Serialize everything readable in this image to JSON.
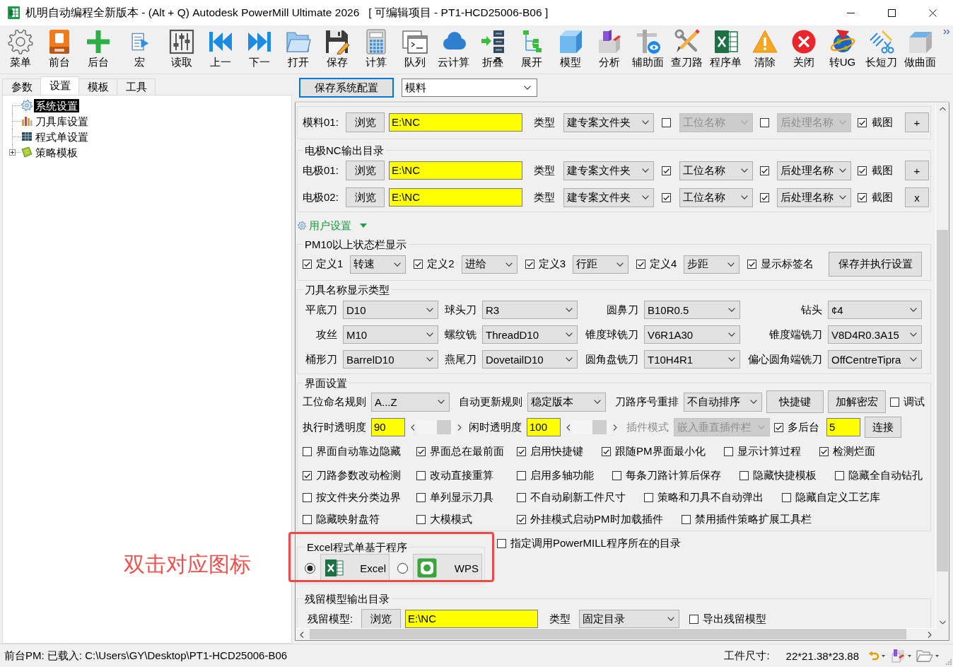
{
  "window": {
    "title": "机明自动编程全新版本 - (Alt + Q) Autodesk PowerMill Ultimate 2026   [ 可编辑项目 - PT1-HCD25006-B06 ]"
  },
  "toolbar": {
    "groups": [
      {
        "items": [
          {
            "label": "菜单"
          },
          {
            "label": "前台"
          },
          {
            "label": "后台"
          }
        ]
      },
      {
        "items": [
          {
            "label": "宏"
          }
        ]
      },
      {
        "items": [
          {
            "label": "读取"
          },
          {
            "label": "上一"
          },
          {
            "label": "下一"
          },
          {
            "label": "打开"
          },
          {
            "label": "保存"
          },
          {
            "label": "计算"
          },
          {
            "label": "队列"
          },
          {
            "label": "云计算"
          },
          {
            "label": "折叠"
          },
          {
            "label": "展开"
          },
          {
            "label": "模型"
          },
          {
            "label": "分析"
          },
          {
            "label": "辅助面"
          },
          {
            "label": "查刀路"
          },
          {
            "label": "程序单"
          },
          {
            "label": "清除"
          },
          {
            "label": "关闭"
          },
          {
            "label": "转UG"
          },
          {
            "label": "长短刀"
          },
          {
            "label": "做曲面"
          }
        ]
      }
    ]
  },
  "left_panel": {
    "tabs": [
      {
        "label": "参数",
        "selected": false
      },
      {
        "label": "设置",
        "selected": true
      },
      {
        "label": "模板",
        "selected": false
      },
      {
        "label": "工具",
        "selected": false
      }
    ],
    "tree": [
      {
        "label": "系统设置",
        "selected": true
      },
      {
        "label": "刀具库设置",
        "selected": false
      },
      {
        "label": "程式单设置",
        "selected": false
      },
      {
        "label": "策略模板",
        "selected": false,
        "expanded": false
      }
    ]
  },
  "annotation": {
    "text": "双击对应图标"
  },
  "right_panel": {
    "save_button": "保存系统配置",
    "profile": {
      "value": "模料"
    },
    "mold_output": {
      "rows": [
        {
          "label": "模料01:",
          "browse": "浏览",
          "path": "E:\\NC",
          "type_label": "类型",
          "type": "建专案文件夹",
          "station": {
            "checked": false,
            "value": "工位名称",
            "disabled": true
          },
          "post": {
            "checked": false,
            "value": "后处理名称",
            "disabled": true
          },
          "snapshot": {
            "checked": true,
            "label": "截图"
          },
          "action": "+"
        }
      ]
    },
    "electrode_output": {
      "title": "电极NC输出目录",
      "rows": [
        {
          "label": "电极01:",
          "browse": "浏览",
          "path": "E:\\NC",
          "type_label": "类型",
          "type": "建专案文件夹",
          "station": {
            "checked": true,
            "value": "工位名称",
            "disabled": false
          },
          "post": {
            "checked": true,
            "value": "后处理名称",
            "disabled": false
          },
          "snapshot": {
            "checked": true,
            "label": "截图"
          },
          "action": "+"
        },
        {
          "label": "电极02:",
          "browse": "浏览",
          "path": "E:\\NC",
          "type_label": "类型",
          "type": "建专案文件夹",
          "station": {
            "checked": true,
            "value": "工位名称",
            "disabled": false
          },
          "post": {
            "checked": true,
            "value": "后处理名称",
            "disabled": false
          },
          "snapshot": {
            "checked": true,
            "label": "截图"
          },
          "action": "x"
        }
      ]
    },
    "user_settings": {
      "label": "用户设置",
      "expanded": true
    },
    "status_display": {
      "title": "PM10以上状态栏显示",
      "fields": [
        {
          "label": "定义1",
          "checked": true,
          "value": "转速"
        },
        {
          "label": "定义2",
          "checked": true,
          "value": "进给"
        },
        {
          "label": "定义3",
          "checked": true,
          "value": "行距"
        },
        {
          "label": "定义4",
          "checked": true,
          "value": "步距"
        }
      ],
      "show_tags": {
        "label": "显示标签名",
        "checked": true
      },
      "apply_button": "保存并执行设置"
    },
    "tool_names": {
      "title": "刀具名称显示类型",
      "fields": [
        {
          "label": "平底刀",
          "value": "D10"
        },
        {
          "label": "球头刀",
          "value": "R3"
        },
        {
          "label": "圆鼻刀",
          "value": "B10R0.5"
        },
        {
          "label": "钻头",
          "value": "¢4"
        },
        {
          "label": "攻丝",
          "value": "M10"
        },
        {
          "label": "螺纹铣",
          "value": "ThreadD10"
        },
        {
          "label": "锥度球铣刀",
          "value": "V6R1A30"
        },
        {
          "label": "锥度端铣刀",
          "value": "V8D4R0.3A15"
        },
        {
          "label": "桶形刀",
          "value": "BarrelD10"
        },
        {
          "label": "燕尾刀",
          "value": "DovetailD10"
        },
        {
          "label": "圆角盘铣刀",
          "value": "T10H4R1"
        },
        {
          "label": "偏心圆角端铣刀",
          "value": "OffCentreTipra"
        }
      ]
    },
    "interface": {
      "title": "界面设置",
      "rows": [
        {
          "items": [
            {
              "kind": "select",
              "label": "工位命名规则",
              "value": "A...Z",
              "disabled": false
            },
            {
              "kind": "select",
              "label": "自动更新规则",
              "value": "稳定版本",
              "disabled": false
            },
            {
              "kind": "select",
              "label": "刀路序号重排",
              "value": "不自动排序",
              "disabled": false
            },
            {
              "kind": "button",
              "label": "快捷键"
            },
            {
              "kind": "button",
              "label": "加解密宏"
            },
            {
              "kind": "checkbox",
              "label": "调试",
              "checked": false
            }
          ]
        },
        {
          "items": [
            {
              "kind": "input",
              "label": "执行时透明度",
              "value": "90"
            },
            {
              "kind": "slider",
              "level": 0.8
            },
            {
              "kind": "input",
              "label": "闲时透明度",
              "value": "100"
            },
            {
              "kind": "slider",
              "level": 0.8
            },
            {
              "kind": "select",
              "label": "插件模式",
              "value": "嵌入垂直插件栏",
              "disabled": true
            },
            {
              "kind": "checkbox",
              "label": "多后台",
              "checked": true
            },
            {
              "kind": "input",
              "value": "5"
            },
            {
              "kind": "button",
              "label": "连接"
            }
          ]
        }
      ],
      "options": [
        {
          "items": [
            {
              "label": "界面自动靠边隐藏",
              "checked": false
            },
            {
              "label": "界面总在最前面",
              "checked": true
            },
            {
              "label": "启用快捷键",
              "checked": true
            },
            {
              "label": "跟随PM界面最小化",
              "checked": true
            },
            {
              "label": "显示计算过程",
              "checked": false
            },
            {
              "label": "检测烂面",
              "checked": true
            }
          ]
        },
        {
          "items": [
            {
              "label": "刀路参数改动检测",
              "checked": true
            },
            {
              "label": "改动直接重算",
              "checked": false
            },
            {
              "label": "启用多轴功能",
              "checked": false
            },
            {
              "label": "每条刀路计算后保存",
              "checked": false
            },
            {
              "label": "隐藏快捷模板",
              "checked": false
            },
            {
              "label": "隐藏全自动钻孔",
              "checked": false
            }
          ]
        },
        {
          "items": [
            {
              "label": "按文件夹分类边界",
              "checked": false
            },
            {
              "label": "单列显示刀具",
              "checked": false
            },
            {
              "label": "不自动刷新工件尺寸",
              "checked": false
            },
            {
              "label": "策略和刀具不自动弹出",
              "checked": false
            },
            {
              "label": "隐藏自定义工艺库",
              "checked": false
            }
          ]
        },
        {
          "items": [
            {
              "label": "隐藏映射盘符",
              "checked": false
            },
            {
              "label": "大模模式",
              "checked": false
            },
            {
              "label": "外挂模式启动PM时加载插件",
              "checked": true
            },
            {
              "label": "禁用插件策略扩展工具栏",
              "checked": false
            }
          ]
        }
      ]
    },
    "program_sheet": {
      "title": "Excel程式单基于程序",
      "choices": [
        {
          "label": "Excel",
          "selected": true
        },
        {
          "label": "WPS",
          "selected": false
        }
      ]
    },
    "powermill_dir": {
      "label": "指定调用PowerMILL程序所在的目录",
      "checked": false
    },
    "residual_output": {
      "title": "残留模型输出目录",
      "label": "残留模型:",
      "browse": "浏览",
      "path": "E:\\NC",
      "type_label": "类型",
      "type": "固定目录",
      "export": {
        "label": "导出残留模型",
        "checked": false
      }
    }
  },
  "status_bar": {
    "message": "前台PM: 已载入: C:\\Users\\GY\\Desktop\\PT1-HCD25006-B06",
    "size_label": "工件尺寸:",
    "size_value": "22*21.38*23.88"
  }
}
